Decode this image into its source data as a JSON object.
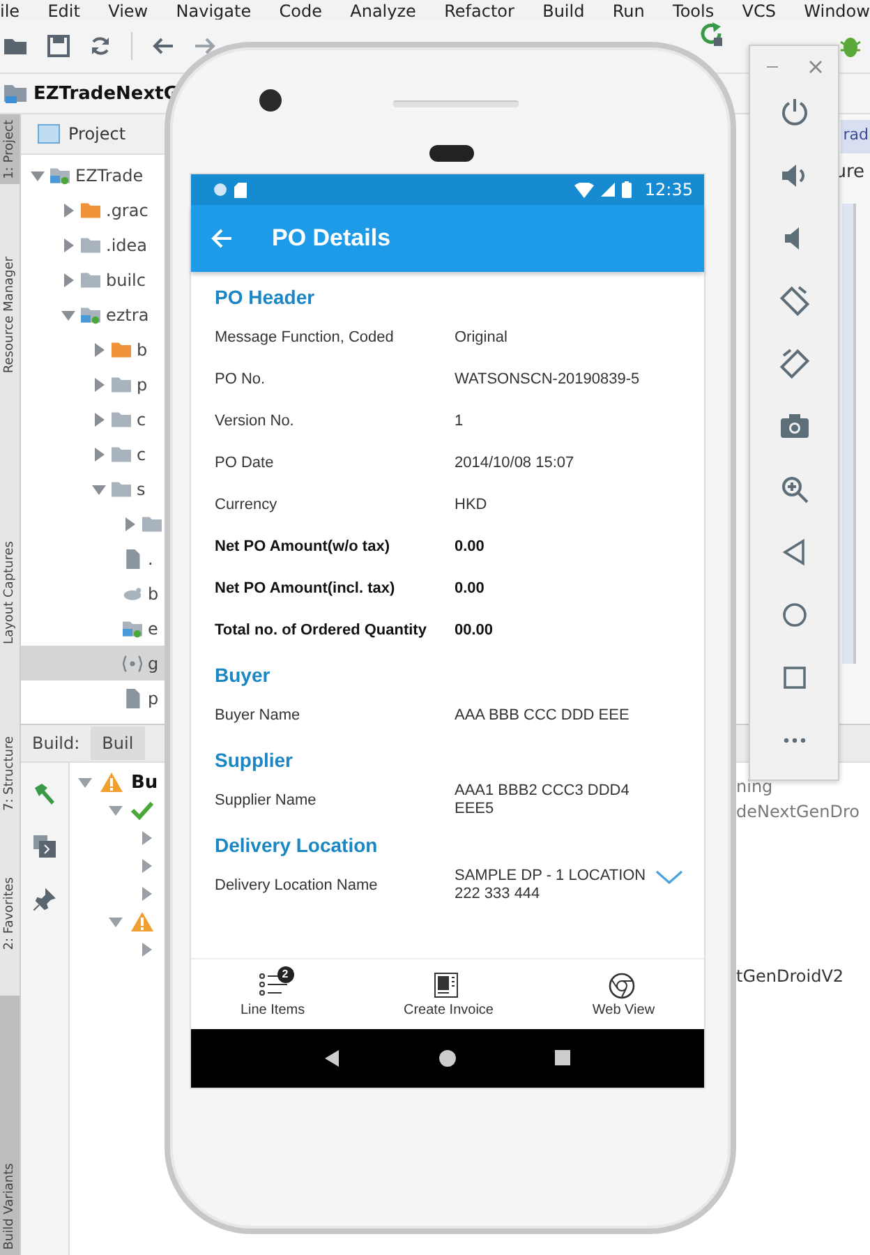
{
  "ide": {
    "menu": [
      "ile",
      "Edit",
      "View",
      "Navigate",
      "Code",
      "Analyze",
      "Refactor",
      "Build",
      "Run",
      "Tools",
      "VCS",
      "Window"
    ],
    "project_title": "EZTradeNextG",
    "project_view": "Project",
    "tool_windows": [
      {
        "label": "1: Project",
        "selected": true
      },
      {
        "label": "Resource Manager",
        "selected": false
      },
      {
        "label": "Layout Captures",
        "selected": false
      },
      {
        "label": "7: Structure",
        "selected": false
      },
      {
        "label": "2: Favorites",
        "selected": false
      },
      {
        "label": "Build Variants",
        "selected": true
      }
    ],
    "tree": [
      {
        "name": "EZTrade",
        "kind": "module",
        "expanded": true,
        "selected": false,
        "children": [
          {
            "name": ".grac",
            "kind": "excluded",
            "expanded": false,
            "selected": false
          },
          {
            "name": ".idea",
            "kind": "folder",
            "expanded": false,
            "selected": false
          },
          {
            "name": "builc",
            "kind": "folder",
            "expanded": false,
            "selected": false
          },
          {
            "name": "eztra",
            "kind": "module",
            "expanded": true,
            "selected": false,
            "children": [
              {
                "name": "b",
                "kind": "excluded",
                "expanded": false,
                "selected": false
              },
              {
                "name": "p",
                "kind": "folder",
                "expanded": false,
                "selected": false
              },
              {
                "name": "c",
                "kind": "folder",
                "expanded": false,
                "selected": false
              },
              {
                "name": "c",
                "kind": "folder",
                "expanded": false,
                "selected": false
              },
              {
                "name": "s",
                "kind": "folder",
                "expanded": true,
                "selected": false,
                "children": [
                  {
                    "kind": "folder",
                    "expanded": false,
                    "selected": false
                  },
                  {
                    "name": ".",
                    "kind": "file",
                    "selected": false
                  },
                  {
                    "name": "b",
                    "kind": "gradle",
                    "selected": false
                  },
                  {
                    "name": "e",
                    "kind": "module",
                    "selected": false
                  },
                  {
                    "name": "g",
                    "kind": "json",
                    "selected": true
                  },
                  {
                    "name": "p",
                    "kind": "file",
                    "selected": false
                  }
                ]
              }
            ]
          }
        ]
      }
    ],
    "editor_tab": "rad",
    "editor_label": "ure",
    "build_tabs": [
      {
        "label": "Build:",
        "selected": false
      },
      {
        "label": "Buil",
        "selected": true
      }
    ],
    "build_tree": [
      {
        "name": "Bu",
        "kind": "warning",
        "expanded": true,
        "children": [
          {
            "kind": "success",
            "expanded": true,
            "children": [
              {
                "expanded": false
              },
              {
                "expanded": false
              },
              {
                "expanded": false
              }
            ]
          },
          {
            "kind": "warning",
            "expanded": true,
            "children": [
              {
                "expanded": false
              }
            ]
          }
        ]
      }
    ],
    "build_output": [
      "ning",
      "deNextGenDro",
      "tGenDroidV2"
    ]
  },
  "phone": {
    "time": "12:35",
    "title": "PO Details",
    "sections": [
      {
        "title": "PO Header",
        "fields": [
          {
            "label": "Message Function, Coded",
            "value": "Original",
            "bold": false,
            "kind": "text"
          },
          {
            "label": "PO No.",
            "value": "WATSONSCN-20190839-5",
            "bold": false,
            "kind": "text"
          },
          {
            "label": "Version No.",
            "value": "1",
            "bold": false,
            "kind": "text"
          },
          {
            "label": "PO Date",
            "value": "2014/10/08 15:07",
            "bold": false,
            "kind": "text"
          },
          {
            "label": "Currency",
            "value": "HKD",
            "bold": false,
            "kind": "text"
          },
          {
            "label": "Net PO Amount(w/o tax)",
            "value": "0.00",
            "bold": true,
            "kind": "text"
          },
          {
            "label": "Net PO Amount(incl. tax)",
            "value": "0.00",
            "bold": true,
            "kind": "text"
          },
          {
            "label": "Total no. of Ordered Quantity",
            "value": "00.00",
            "bold": true,
            "kind": "text"
          }
        ]
      },
      {
        "title": "Buyer",
        "fields": [
          {
            "label": "Buyer Name",
            "value": "AAA BBB CCC DDD EEE",
            "bold": false,
            "kind": "text"
          }
        ]
      },
      {
        "title": "Supplier",
        "fields": [
          {
            "label": "Supplier Name",
            "value": "AAA1 BBB2 CCC3 DDD4 EEE5",
            "bold": false,
            "kind": "text"
          }
        ]
      },
      {
        "title": "Delivery Location",
        "fields": [
          {
            "label": "Delivery Location Name",
            "value": "SAMPLE DP - 1 LOCATION 222 333 444",
            "bold": false,
            "kind": "dropdown"
          }
        ]
      }
    ],
    "bottom_nav": [
      {
        "label": "Line Items",
        "kind": "list",
        "badge": "2"
      },
      {
        "label": "Create Invoice",
        "kind": "invoice"
      },
      {
        "label": "Web View",
        "kind": "web"
      }
    ]
  }
}
